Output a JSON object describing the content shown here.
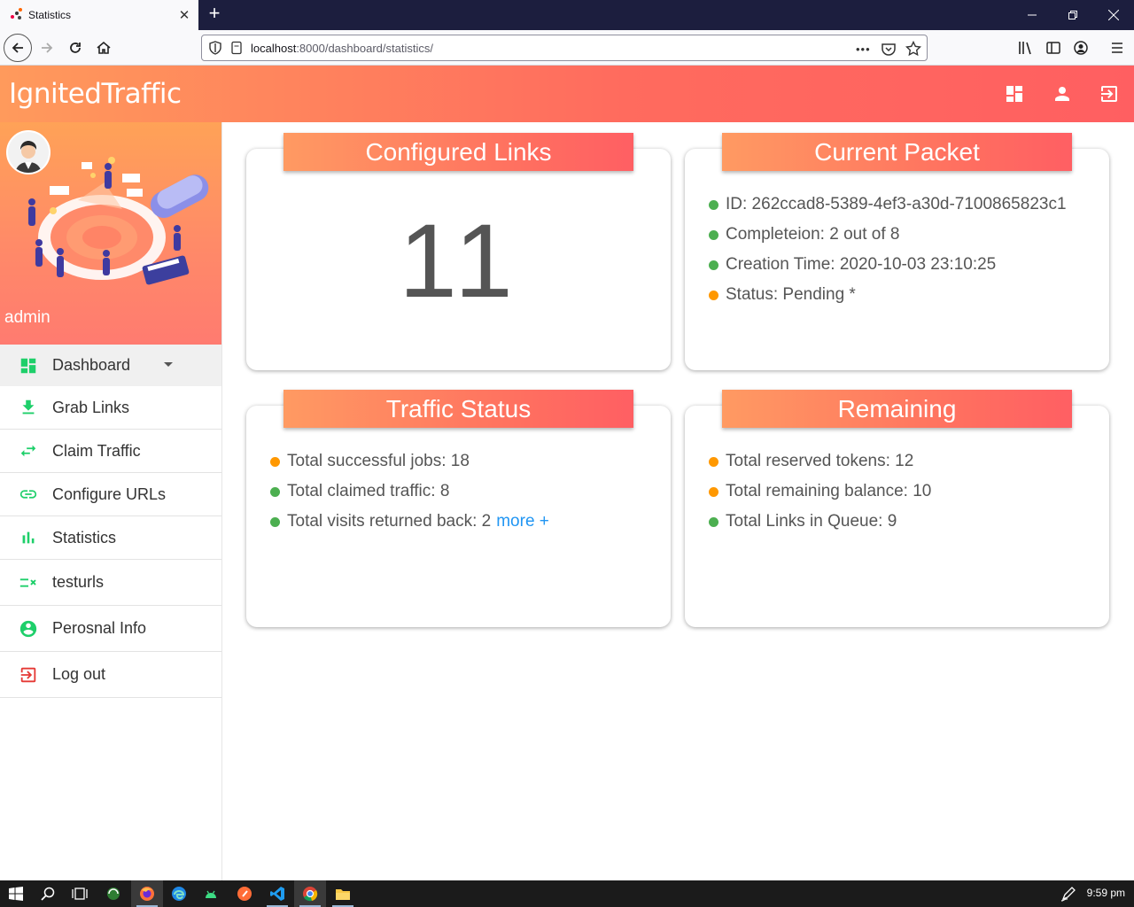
{
  "browser": {
    "tab_title": "Statistics",
    "url_host": "localhost",
    "url_rest": ":8000/dashboard/statistics/",
    "url_more": "•••"
  },
  "app": {
    "brand": "IgnitedTraffic",
    "user": "admin"
  },
  "menu": [
    {
      "label": "Dashboard",
      "icon": "dashboard-icon"
    },
    {
      "label": "Grab Links",
      "icon": "download-icon"
    },
    {
      "label": "Claim Traffic",
      "icon": "swap-arrows-icon"
    },
    {
      "label": "Configure URLs",
      "icon": "link-icon"
    },
    {
      "label": "Statistics",
      "icon": "bar-chart-icon"
    },
    {
      "label": "testurls",
      "icon": "rule-icon"
    },
    {
      "label": "Perosnal Info",
      "icon": "account-circle-icon"
    },
    {
      "label": "Log out",
      "icon": "logout-icon"
    }
  ],
  "cards": {
    "links": {
      "title": "Configured Links",
      "value": "11"
    },
    "packet": {
      "title": "Current Packet",
      "items": [
        {
          "text": "ID: 262ccad8-5389-4ef3-a30d-7100865823c1",
          "status": "green"
        },
        {
          "text": "Completeion: 2 out of 8",
          "status": "green"
        },
        {
          "text": "Creation Time: 2020-10-03 23:10:25",
          "status": "green"
        },
        {
          "text": "Status: Pending *",
          "status": "orange"
        }
      ]
    },
    "traffic": {
      "title": "Traffic Status",
      "items": [
        {
          "text": "Total successful jobs: 18",
          "status": "orange"
        },
        {
          "text": "Total claimed traffic: 8",
          "status": "green"
        },
        {
          "text": "Total visits returned back: 2",
          "status": "green"
        }
      ],
      "more_link": "more +"
    },
    "remaining": {
      "title": "Remaining",
      "items": [
        {
          "text": "Total reserved tokens: 12",
          "status": "orange"
        },
        {
          "text": "Total remaining balance: 10",
          "status": "orange"
        },
        {
          "text": "Total Links in Queue: 9",
          "status": "green"
        }
      ]
    }
  },
  "taskbar": {
    "clock": "9:59 pm"
  },
  "colors": {
    "accent_orange": "#ff9a5c",
    "accent_red": "#ff5f61",
    "green": "#4caf50",
    "orange": "#ff9800",
    "link": "#2196f3"
  }
}
